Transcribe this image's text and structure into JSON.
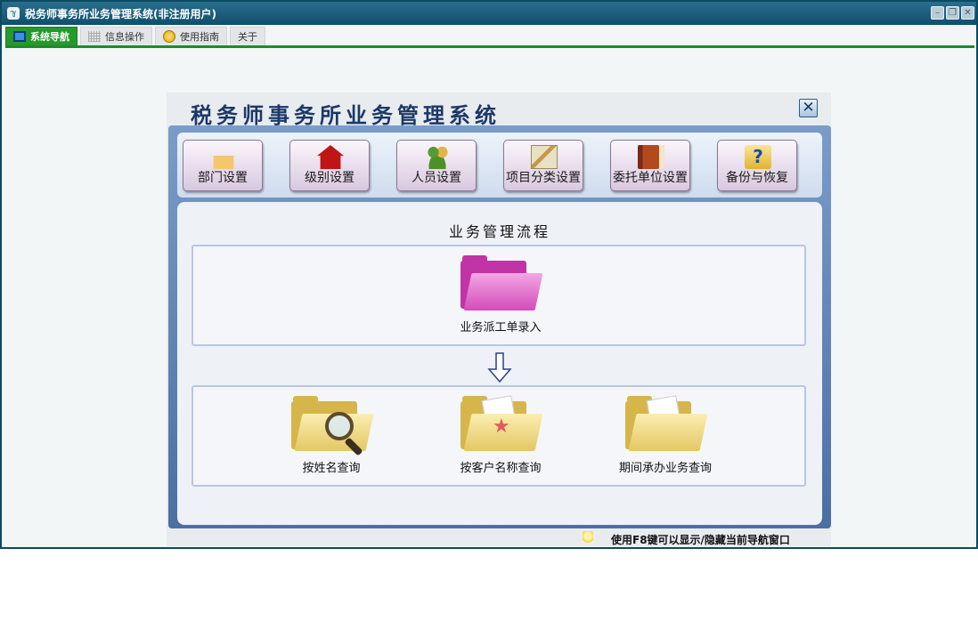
{
  "window": {
    "title": "税务师事务所业务管理系统(非注册用户)",
    "app_icon_text": "ℽ",
    "controls": {
      "minimize": "–",
      "restore": "❐",
      "close": "✕"
    }
  },
  "tabs": [
    {
      "label": "系统导航"
    },
    {
      "label": "信息操作"
    },
    {
      "label": "使用指南"
    },
    {
      "label": "关于"
    }
  ],
  "dialog": {
    "title": "税务师事务所业务管理系统",
    "close_glyph": "✕",
    "toolbar": [
      {
        "label": "部门设置",
        "icon": "house-orange-icon"
      },
      {
        "label": "级别设置",
        "icon": "house-red-icon"
      },
      {
        "label": "人员设置",
        "icon": "people-icon"
      },
      {
        "label": "项目分类设置",
        "icon": "tools-icon"
      },
      {
        "label": "委托单位设置",
        "icon": "address-book-icon"
      },
      {
        "label": "备份与恢复",
        "icon": "help-folder-icon"
      }
    ],
    "workflow": {
      "title": "业务管理流程",
      "entry": {
        "label": "业务派工单录入"
      },
      "arrow": "⇓",
      "queries": [
        {
          "label": "按姓名查询"
        },
        {
          "label": "按客户名称查询"
        },
        {
          "label": "期间承办业务查询"
        }
      ]
    },
    "status": "使用F8键可以显示/隐藏当前导航窗口"
  },
  "colors": {
    "titlebar": "#0f4f6c",
    "active_tab": "#249a2c",
    "dialog_title": "#1b3868",
    "pink_folder": "#d24cbc",
    "yellow_folder": "#e4c765"
  }
}
